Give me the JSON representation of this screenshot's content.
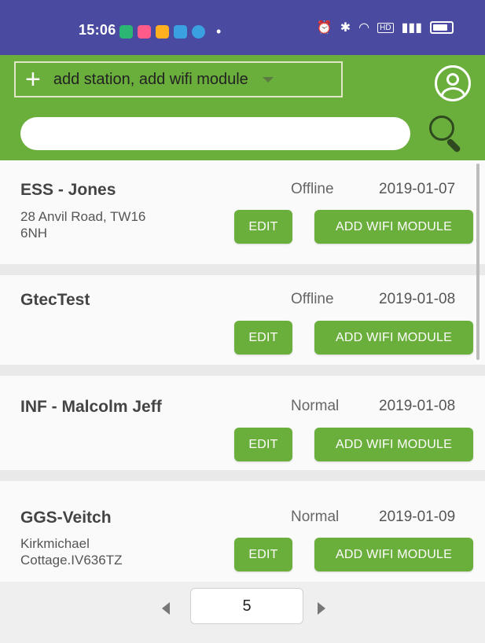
{
  "status_bar": {
    "time": "15:06"
  },
  "toolbar": {
    "station_select_label": "add station, add wifi module"
  },
  "search": {
    "value": "",
    "placeholder": ""
  },
  "stations": [
    {
      "name": "ESS - Jones",
      "status": "Offline",
      "date": "2019-01-07",
      "address": "28 Anvil Road, TW16\n6NH",
      "edit_label": "EDIT",
      "add_label": "ADD WIFI MODULE"
    },
    {
      "name": "GtecTest",
      "status": "Offline",
      "date": "2019-01-08",
      "address": "",
      "edit_label": "EDIT",
      "add_label": "ADD WIFI MODULE"
    },
    {
      "name": "INF - Malcolm Jeff",
      "status": "Normal",
      "date": "2019-01-08",
      "address": "",
      "edit_label": "EDIT",
      "add_label": "ADD WIFI MODULE"
    },
    {
      "name": "GGS-Veitch",
      "status": "Normal",
      "date": "2019-01-09",
      "address": "Kirkmichael\nCottage.IV636TZ",
      "edit_label": "EDIT",
      "add_label": "ADD WIFI MODULE"
    }
  ],
  "pager": {
    "page": "5"
  },
  "colors": {
    "accent_green": "#6aae3c",
    "status_bar": "#4a4aa0"
  }
}
